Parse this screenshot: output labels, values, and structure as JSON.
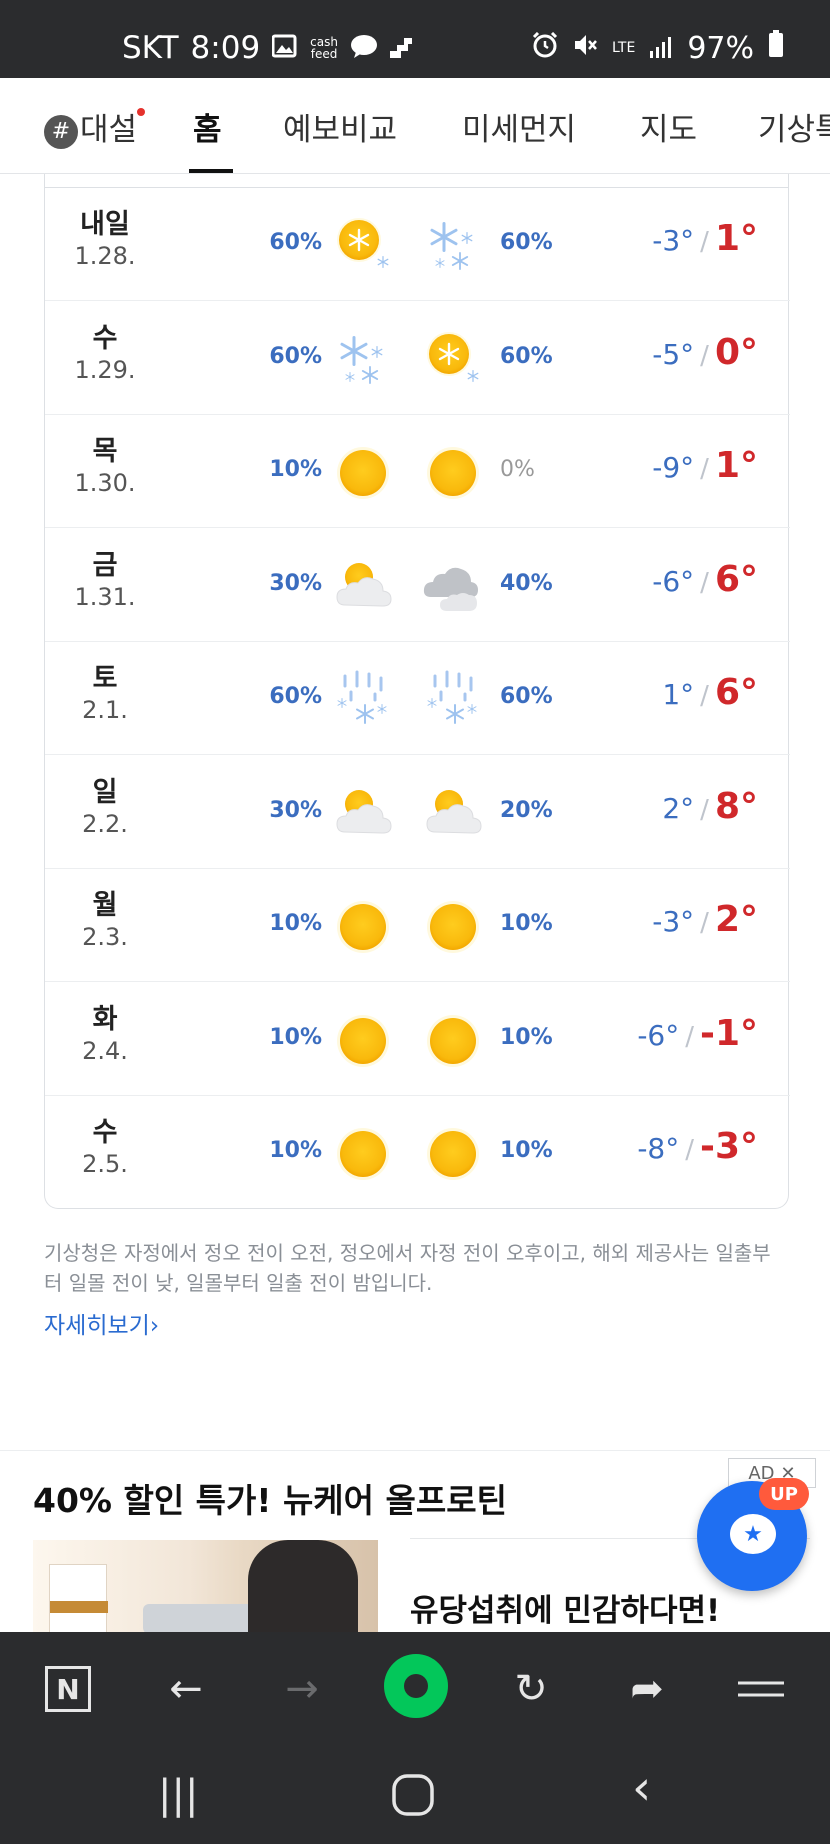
{
  "status_bar": {
    "carrier": "SKT",
    "time": "8:09",
    "cash_top": "cash",
    "cash_bottom": "feed",
    "network": "LTE",
    "battery": "97%"
  },
  "nav": {
    "tabs": [
      {
        "label": "대설"
      },
      {
        "label": "홈"
      },
      {
        "label": "예보비교"
      },
      {
        "label": "미세먼지"
      },
      {
        "label": "지도"
      },
      {
        "label": "기상특"
      }
    ],
    "hash_symbol": "#",
    "active_tab": "홈"
  },
  "forecast": [
    {
      "day": "내일",
      "date": "1.28.",
      "am_pct": "60%",
      "am_icon": "sun-snow",
      "pm_icon": "snow",
      "pm_pct": "60%",
      "low": "-3°",
      "high": "1°"
    },
    {
      "day": "수",
      "date": "1.29.",
      "am_pct": "60%",
      "am_icon": "snow",
      "pm_icon": "sun-snow",
      "pm_pct": "60%",
      "low": "-5°",
      "high": "0°"
    },
    {
      "day": "목",
      "date": "1.30.",
      "am_pct": "10%",
      "am_icon": "sun",
      "pm_icon": "sun",
      "pm_pct": "0%",
      "low": "-9°",
      "high": "1°"
    },
    {
      "day": "금",
      "date": "1.31.",
      "am_pct": "30%",
      "am_icon": "partly-cloudy",
      "pm_icon": "cloudy",
      "pm_pct": "40%",
      "low": "-6°",
      "high": "6°"
    },
    {
      "day": "토",
      "date": "2.1.",
      "am_pct": "60%",
      "am_icon": "rain-snow",
      "pm_icon": "rain-snow",
      "pm_pct": "60%",
      "low": "1°",
      "high": "6°"
    },
    {
      "day": "일",
      "date": "2.2.",
      "am_pct": "30%",
      "am_icon": "partly-cloudy",
      "pm_icon": "partly-cloudy",
      "pm_pct": "20%",
      "low": "2°",
      "high": "8°"
    },
    {
      "day": "월",
      "date": "2.3.",
      "am_pct": "10%",
      "am_icon": "sun",
      "pm_icon": "sun",
      "pm_pct": "10%",
      "low": "-3°",
      "high": "2°"
    },
    {
      "day": "화",
      "date": "2.4.",
      "am_pct": "10%",
      "am_icon": "sun",
      "pm_icon": "sun",
      "pm_pct": "10%",
      "low": "-6°",
      "high": "-1°"
    },
    {
      "day": "수",
      "date": "2.5.",
      "am_pct": "10%",
      "am_icon": "sun",
      "pm_icon": "sun",
      "pm_pct": "10%",
      "low": "-8°",
      "high": "-3°"
    }
  ],
  "temp_separator": "/",
  "note": "기상청은 자정에서 정오 전이 오전, 정오에서 자정 전이 오후이고, 해외 제공사는 일출부터 일몰 전이 낮, 일몰부터 일출 전이 밤입니다.",
  "more_link": "자세히보기",
  "more_chevron": "›",
  "ad": {
    "title": "40% 할인 특가! 뉴케어 올프로틴",
    "badge": "AD",
    "badge_close": "✕",
    "text": "유당섭취에 민감하다면!"
  },
  "fab": {
    "badge": "UP",
    "icon": "★"
  },
  "toolbar": {
    "n_label": "N",
    "back": "←",
    "forward": "→",
    "reload": "↻",
    "share": "➦",
    "menu": "☰"
  },
  "system_nav": {
    "recents": "|||",
    "home": "○",
    "back": "‹"
  },
  "colors": {
    "low_temp": "#3b6dbf",
    "high_temp": "#d0282b",
    "sun": "#fbbf16",
    "link": "#2a6bd0",
    "fab": "#1f6ff2",
    "home_green": "#03c75a"
  }
}
